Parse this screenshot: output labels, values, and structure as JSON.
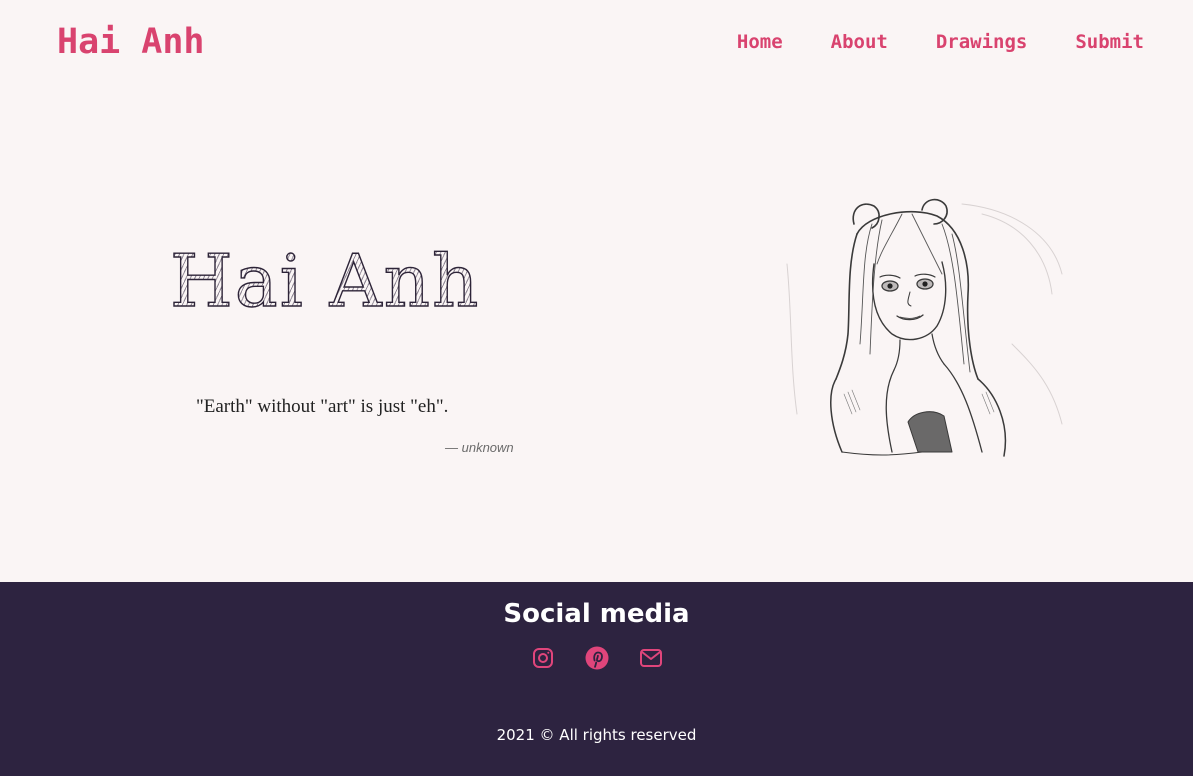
{
  "header": {
    "brand": "Hai Anh",
    "nav": [
      "Home",
      "About",
      "Drawings",
      "Submit"
    ]
  },
  "hero": {
    "title": "Hai Anh",
    "quote": "\"Earth\" without \"art\" is just \"eh\".",
    "quote_author": "— unknown"
  },
  "footer": {
    "title": "Social media",
    "icons": [
      "instagram-icon",
      "pinterest-icon",
      "mail-icon"
    ],
    "copyright": "2021 © All rights reserved"
  },
  "colors": {
    "accent": "#d9436f",
    "background": "#faf5f5",
    "footer_bg": "#2d2340"
  }
}
